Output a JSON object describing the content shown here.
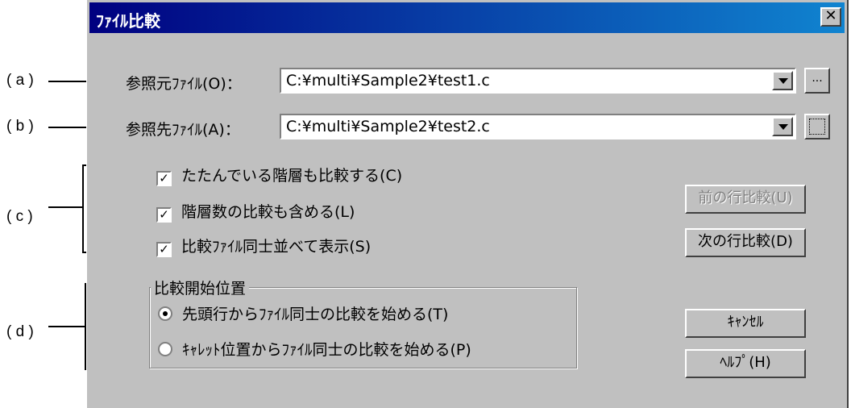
{
  "dialog": {
    "title": "ﾌｧｲﾙ比較",
    "close_label": "✕",
    "source_label": "参照元ﾌｧｲﾙ(O)：",
    "source_value": "C:¥multi¥Sample2¥test1.c",
    "target_label": "参照先ﾌｧｲﾙ(A)：",
    "target_value": "C:¥multi¥Sample2¥test2.c",
    "browse_label": "...",
    "checkboxes": [
      {
        "label": "たたんでいる階層も比較する(C)",
        "checked": true
      },
      {
        "label": "階層数の比較も含める(L)",
        "checked": true
      },
      {
        "label": "比較ﾌｧｲﾙ同士並べて表示(S)",
        "checked": true
      }
    ],
    "prev_button": "前の行比較(U)",
    "next_button": "次の行比較(D)",
    "group_title": "比較開始位置",
    "radios": [
      {
        "label": "先頭行からﾌｧｲﾙ同士の比較を始める(T)",
        "selected": true
      },
      {
        "label": "ｷｬﾚｯﾄ位置からﾌｧｲﾙ同士の比較を始める(P)",
        "selected": false
      }
    ],
    "cancel_button": "ｷｬﾝｾﾙ",
    "help_button": "ﾍﾙﾌﾟ(H)"
  },
  "annotations": {
    "a": "( a )",
    "b": "( b )",
    "c": "( c )",
    "d": "( d )"
  },
  "colors": {
    "title_gradient_start": "#000080",
    "title_gradient_end": "#1084d0",
    "face": "#c0c0c0"
  }
}
